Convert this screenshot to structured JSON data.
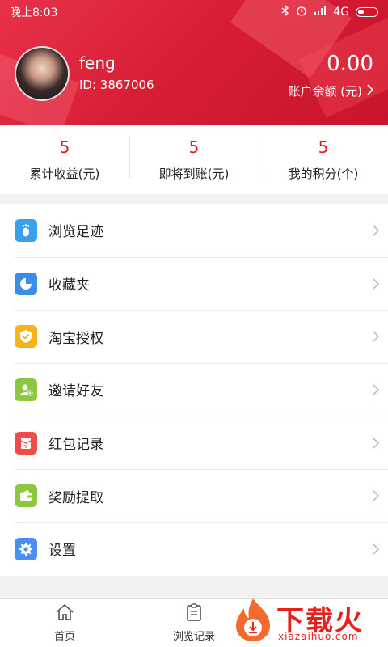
{
  "status_bar": {
    "time": "晚上8:03",
    "network": "4G"
  },
  "profile": {
    "name": "feng",
    "id_text": "ID: 3867006",
    "balance": "0.00",
    "balance_label": "账户余额 (元)"
  },
  "stats": [
    {
      "value": "5",
      "label": "累计收益(元)"
    },
    {
      "value": "5",
      "label": "即将到账(元)"
    },
    {
      "value": "5",
      "label": "我的积分(个)"
    }
  ],
  "menu": [
    {
      "label": "浏览足迹",
      "icon": "footprint-icon",
      "color": "#3aa0ec"
    },
    {
      "label": "收藏夹",
      "icon": "pie-chart-icon",
      "color": "#3a8ee8"
    },
    {
      "label": "淘宝授权",
      "icon": "shield-check-icon",
      "color": "#f6b216"
    },
    {
      "label": "邀请好友",
      "icon": "add-user-icon",
      "color": "#8dc63f"
    },
    {
      "label": "红包记录",
      "icon": "red-envelope-icon",
      "color": "#ef4b4b"
    },
    {
      "label": "奖励提取",
      "icon": "wallet-icon",
      "color": "#8dc63f"
    },
    {
      "label": "设置",
      "icon": "gear-icon",
      "color": "#4a8ef0"
    }
  ],
  "tabs": [
    {
      "label": "首页",
      "icon": "home-icon"
    },
    {
      "label": "浏览记录",
      "icon": "clipboard-icon"
    }
  ],
  "watermark": {
    "brand": "下载火",
    "url": "xiazaihuo.com",
    "color": "#e8201c"
  }
}
